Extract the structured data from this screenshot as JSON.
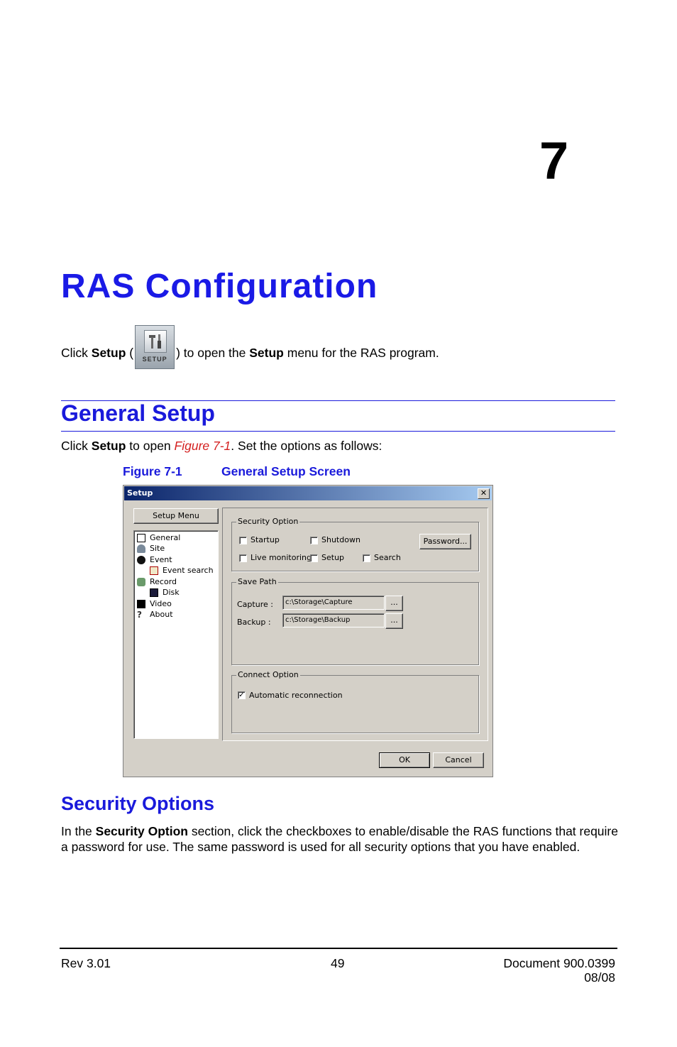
{
  "chapter": {
    "number": "7",
    "title": "RAS Configuration"
  },
  "intro": {
    "pre": "Click ",
    "setup_bold": "Setup",
    "open_paren": " (",
    "icon_label": "SETUP",
    "close_paren": ") to open the ",
    "setup_bold2": "Setup",
    "post": " menu for the RAS program."
  },
  "general_setup": {
    "heading": "General Setup",
    "pre": "Click ",
    "setup_bold": "Setup",
    "mid": " to open ",
    "figure_ref": "Figure 7-1",
    "post": ". Set the options as follows:"
  },
  "figure": {
    "label": "Figure 7-1",
    "title": "General Setup Screen"
  },
  "dialog": {
    "title": "Setup",
    "close_glyph": "✕",
    "menu_button": "Setup Menu",
    "tree": [
      "General",
      "Site",
      "Event",
      "Event search",
      "Record",
      "Disk",
      "Video",
      "About"
    ],
    "security": {
      "label": "Security Option",
      "startup": "Startup",
      "shutdown": "Shutdown",
      "live": "Live monitoring",
      "setup": "Setup",
      "search": "Search",
      "password_button": "Password..."
    },
    "save_path": {
      "label": "Save Path",
      "capture_label": "Capture :",
      "capture_value": "c:\\Storage\\Capture",
      "backup_label": "Backup :",
      "backup_value": "c:\\Storage\\Backup",
      "browse": "..."
    },
    "connect": {
      "label": "Connect Option",
      "auto": "Automatic reconnection",
      "check_glyph": "✓"
    },
    "ok": "OK",
    "cancel": "Cancel"
  },
  "security_options": {
    "heading": "Security Options",
    "pre": "In the ",
    "bold": "Security Option",
    "post": " section, click the checkboxes to enable/disable the RAS functions that require a password for use. The same password is used for all security options that you have enabled."
  },
  "footer": {
    "rev": "Rev 3.01",
    "page": "49",
    "doc": "Document 900.0399",
    "date": "08/08"
  }
}
